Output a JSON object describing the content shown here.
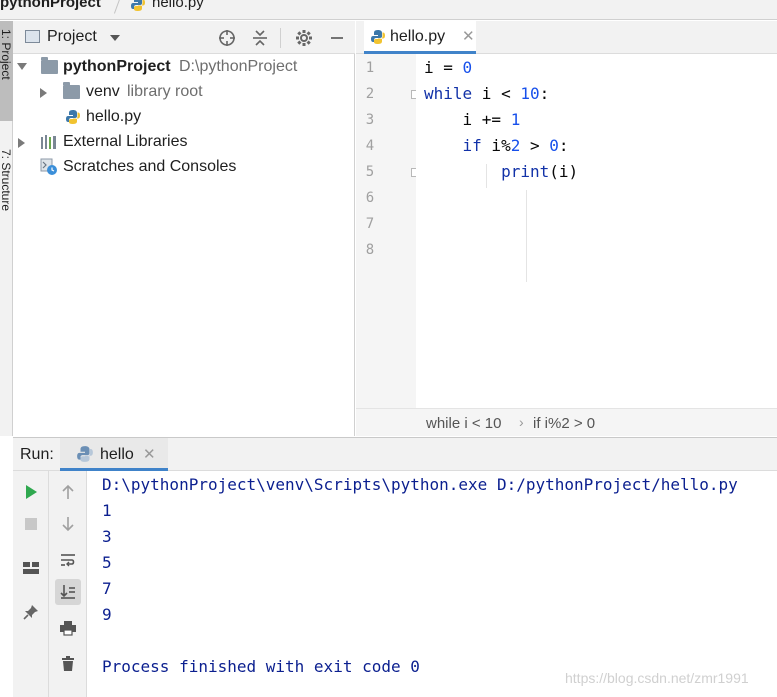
{
  "navbar": {
    "project": "pythonProject",
    "file": "hello.py"
  },
  "toolstrip": {
    "tab_project": "1: Project",
    "tab_structure": "7: Structure"
  },
  "project_panel": {
    "title": "Project",
    "tree": {
      "root_name": "pythonProject",
      "root_path": "D:\\pythonProject",
      "venv_name": "venv",
      "venv_hint": "library root",
      "file_name": "hello.py",
      "ext_libs": "External Libraries",
      "scratches": "Scratches and Consoles"
    }
  },
  "editor": {
    "tab_label": "hello.py",
    "line_numbers": [
      "1",
      "2",
      "3",
      "4",
      "5",
      "6",
      "7",
      "8"
    ],
    "breadcrumb": [
      "while i < 10",
      "if i%2 > 0"
    ]
  },
  "run": {
    "label": "Run:",
    "tab_label": "hello",
    "console": [
      "D:\\pythonProject\\venv\\Scripts\\python.exe D:/pythonProject/hello.py",
      "1",
      "3",
      "5",
      "7",
      "9",
      "",
      "Process finished with exit code 0"
    ]
  },
  "watermark": "https://blog.csdn.net/zmr1991",
  "colors": {
    "accent_tab": "#4083c9",
    "keyword": "#1232a8",
    "number": "#1750eb",
    "console_text": "#0b1f8f",
    "run_green": "#2fa84f"
  }
}
